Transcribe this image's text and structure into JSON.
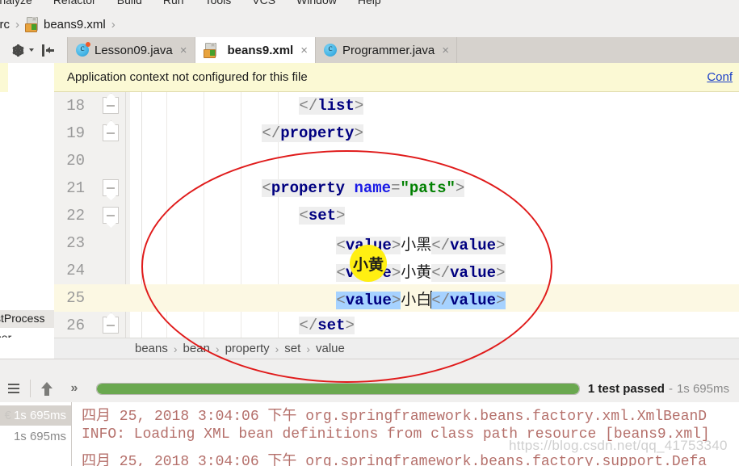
{
  "menubar": {
    "items": [
      "Analyze",
      "Refactor",
      "Build",
      "Run",
      "Tools",
      "VCS",
      "Window",
      "Help"
    ]
  },
  "navbar": {
    "crumbs": [
      "src",
      "beans9.xml"
    ],
    "file_icon": "xml-file-icon",
    "separator": "›"
  },
  "tabtools": {
    "gear_icon": "gear-icon",
    "gear_caret_icon": "chevron-down-icon",
    "collapse_icon": "collapse-panel-icon"
  },
  "tabs": [
    {
      "label": "Lesson09.java",
      "icon": "java-class-icon",
      "close": "×",
      "active": false
    },
    {
      "label": "beans9.xml",
      "icon": "xml-file-icon",
      "close": "×",
      "active": true
    },
    {
      "label": "Programmer.java",
      "icon": "java-class-icon",
      "close": "×",
      "active": false
    }
  ],
  "notification": {
    "message": "Application context not configured for this file",
    "action_label": "Conf",
    "bg_color": "#fbf9d4",
    "link_color": "#1a3ec8"
  },
  "left_panel": {
    "items": [
      "stProcess",
      "ner"
    ]
  },
  "editor": {
    "lines": [
      {
        "num": "18",
        "indent": 3,
        "fold": "up",
        "text": "</list>",
        "selected": false,
        "caret": false
      },
      {
        "num": "19",
        "indent": 2,
        "fold": "up",
        "text": "</property>",
        "selected": false,
        "caret": false
      },
      {
        "num": "20",
        "indent": 0,
        "fold": "none",
        "text": "",
        "selected": false,
        "caret": false
      },
      {
        "num": "21",
        "indent": 2,
        "fold": "down",
        "text": "<property name=\"pats\">",
        "selected": false,
        "caret": false
      },
      {
        "num": "22",
        "indent": 3,
        "fold": "down",
        "text": "<set>",
        "selected": false,
        "caret": false
      },
      {
        "num": "23",
        "indent": 4,
        "fold": "none",
        "text": "<value>小黑</value>",
        "selected": false,
        "caret": false
      },
      {
        "num": "24",
        "indent": 4,
        "fold": "none",
        "text": "<value>小黄</value>",
        "selected": false,
        "caret": false
      },
      {
        "num": "25",
        "indent": 4,
        "fold": "none",
        "text": "<value>小白</value>",
        "selected": true,
        "caret": true
      },
      {
        "num": "26",
        "indent": 3,
        "fold": "up",
        "text": "</set>",
        "selected": false,
        "caret": false
      }
    ],
    "tokens": {
      "bracket": "‹",
      "value_tag": "value",
      "set_tag": "set",
      "list_tag": "list",
      "property_tag": "property",
      "attr_name": "name",
      "attr_value": "pats",
      "pet_black": "小黑",
      "pet_yellow": "小黄",
      "pet_white": "小白"
    },
    "caret_line_color": "#fcf8e3",
    "selection_color": "#a6d2ff"
  },
  "annotation": {
    "ellipse_color": "#e01b1b",
    "spotlight_color": "#ffef12",
    "spotlight_text": "小黄"
  },
  "code_breadcrumb": {
    "crumbs": [
      "beans",
      "bean",
      "property",
      "set",
      "value"
    ],
    "separator": "›"
  },
  "runbar": {
    "menu_icon": "hamburger-icon",
    "up_icon": "up-arrow-icon",
    "expand_icon": "»",
    "progress_percent": 100,
    "progress_color": "#6aa84f",
    "status_text": "1 test passed",
    "status_dash": "-",
    "status_duration": "1s 695ms"
  },
  "test_tree": {
    "rows": [
      {
        "prefix": "€",
        "duration": "1s 695ms",
        "selected": true
      },
      {
        "prefix": "",
        "duration": "1s 695ms",
        "selected": false
      }
    ]
  },
  "console": {
    "lines": [
      "四月 25, 2018 3:04:06 下午 org.springframework.beans.factory.xml.XmlBeanD",
      "INFO: Loading XML bean definitions from class path resource [beans9.xml]",
      "四月 25, 2018 3:04:06 下午 org.springframework.beans.factory.support.Defa"
    ],
    "text_color": "#b5706b"
  },
  "watermark": {
    "text": "https://blog.csdn.net/qq_41753340"
  }
}
